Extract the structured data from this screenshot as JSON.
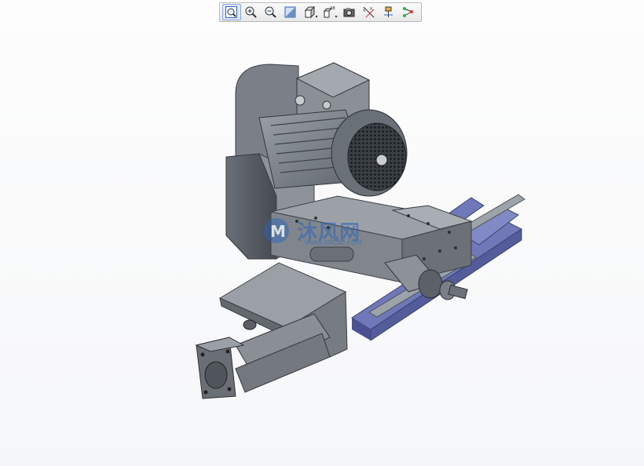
{
  "toolbar": {
    "buttons": [
      {
        "name": "zoom-fit",
        "icon": "zoom-fit-icon"
      },
      {
        "name": "zoom-in",
        "icon": "zoom-in-icon"
      },
      {
        "name": "zoom-out",
        "icon": "zoom-out-icon"
      },
      {
        "name": "shading",
        "icon": "shading-icon"
      },
      {
        "name": "view-orientation",
        "icon": "cube-view-icon"
      },
      {
        "name": "annotation-display",
        "icon": "annotation-icon"
      },
      {
        "name": "snapshot",
        "icon": "camera-icon"
      },
      {
        "name": "datum-display",
        "icon": "datum-axes-icon"
      },
      {
        "name": "spin-center",
        "icon": "spin-center-icon"
      },
      {
        "name": "model-tree",
        "icon": "tree-connector-icon"
      }
    ]
  },
  "watermark": {
    "brand_cn": "沐风网",
    "url": "www.mfcad.com"
  },
  "colors": {
    "body_gray": "#7c8188",
    "rail_blue": "#6f78b8",
    "accent": "#2a64b8"
  }
}
